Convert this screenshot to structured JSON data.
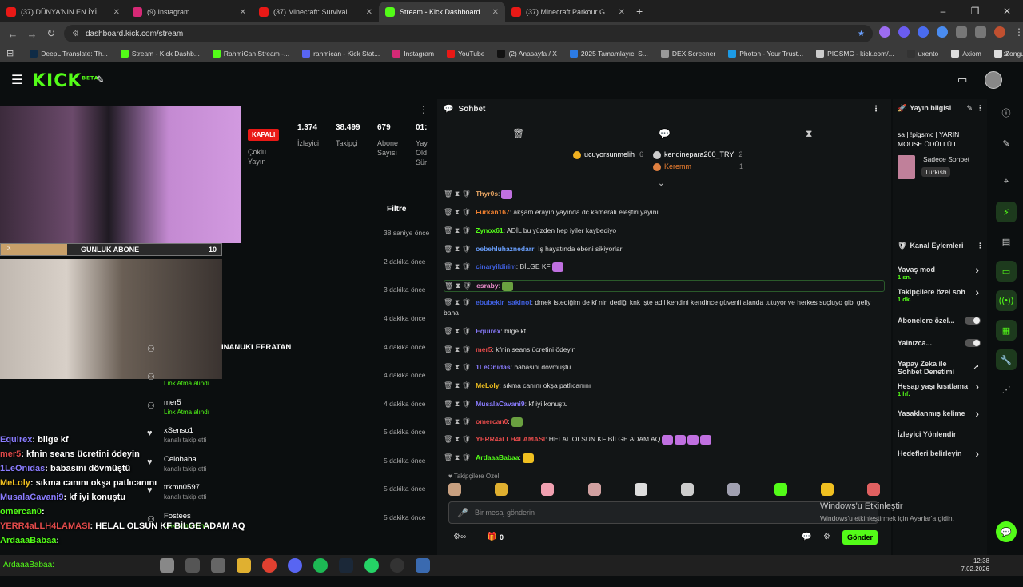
{
  "tabs": [
    {
      "title": "(37) DÜNYA'NIN EN İYİ PVPCİSİ",
      "color": "#e91916",
      "active": false
    },
    {
      "title": "(9) Instagram",
      "color": "#d62976",
      "active": false
    },
    {
      "title": "(37) Minecraft: Survival Games",
      "color": "#e91916",
      "active": false
    },
    {
      "title": "Stream - Kick Dashboard",
      "color": "#53fc18",
      "active": true
    },
    {
      "title": "(37) Minecraft Parkour Gameplay",
      "color": "#e91916",
      "active": false
    }
  ],
  "url": "dashboard.kick.com/stream",
  "bookmarks": [
    {
      "label": "DeepL Translate: Th...",
      "color": "#0f2b46"
    },
    {
      "label": "Stream - Kick Dashb...",
      "color": "#53fc18"
    },
    {
      "label": "RahmiCan Stream -...",
      "color": "#53fc18"
    },
    {
      "label": "rahmican - Kick Stat...",
      "color": "#5865f2"
    },
    {
      "label": "Instagram",
      "color": "#d62976"
    },
    {
      "label": "YouTube",
      "color": "#e91916"
    },
    {
      "label": "(2) Anasayfa / X",
      "color": "#111111"
    },
    {
      "label": "2025 Tamamlayıcı S...",
      "color": "#2c7be5"
    },
    {
      "label": "DEX Screener",
      "color": "#999999"
    },
    {
      "label": "Photon - Your Trust...",
      "color": "#1c9be6"
    },
    {
      "label": "PIGSMC - kick.com/...",
      "color": "#cccccc"
    },
    {
      "label": "uxento",
      "color": "#333333"
    },
    {
      "label": "Axiom",
      "color": "#dddddd"
    },
    {
      "label": "Zonguldak İngilizce...",
      "color": "#dddddd"
    }
  ],
  "kick": {
    "logo": "KICK",
    "logo_sup": "BETA"
  },
  "goal": {
    "label": "GUNLUK ABONE",
    "count": "10",
    "fill_fraction": 0.3,
    "stamp": "3"
  },
  "stats": {
    "status": "KAPALI",
    "status_sub": "Çoklu Yayın",
    "items": [
      {
        "value": "1.374",
        "label": "İzleyici"
      },
      {
        "value": "38.499",
        "label": "Takipçi"
      },
      {
        "value": "679",
        "label": "Abone Sayısı"
      },
      {
        "value": "01:",
        "label": "Yay Old Sür"
      }
    ]
  },
  "activity_filter": "Filtre",
  "activity": [
    {
      "name": "",
      "desc": "",
      "time": "38 saniye önce"
    },
    {
      "name": "",
      "desc": "",
      "time": "2 dakika önce"
    },
    {
      "name": "",
      "desc": "",
      "time": "3 dakika önce"
    },
    {
      "name": "",
      "desc": "",
      "time": "4 dakika önce"
    },
    {
      "name": "INANUKLEERATAN",
      "desc": "",
      "time": "4 dakika önce"
    },
    {
      "name": "",
      "desc": "Link Atma alındı",
      "time": "4 dakika önce"
    },
    {
      "name": "mer5",
      "desc": "Link Atma alındı",
      "time": "4 dakika önce"
    },
    {
      "name": "xSenso1",
      "desc": "kanalı takip etti",
      "time": "5 dakika önce"
    },
    {
      "name": "Celobaba",
      "desc": "kanalı takip etti",
      "time": "5 dakika önce"
    },
    {
      "name": "trkmn0597",
      "desc": "kanalı takip etti",
      "time": "5 dakika önce"
    },
    {
      "name": "Fostees",
      "desc": "Link Atma alındı",
      "time": "5 dakika önce"
    }
  ],
  "overlay_chat": [
    {
      "user": "Equirex",
      "text": ": bilge kf",
      "color": "#8a7cff"
    },
    {
      "user": "mer5",
      "text": ": kfnin seans ücretini ödeyin",
      "color": "#e24a4a"
    },
    {
      "user": "1LeOnidas",
      "text": ": babasini dövmüştü",
      "color": "#8a7cff"
    },
    {
      "user": "MeLoly",
      "text": ": sıkma canını okşa patlıcanını",
      "color": "#f0c020"
    },
    {
      "user": "MusalaCavani9",
      "text": ": kf iyi konuştu",
      "color": "#8a7cff"
    },
    {
      "user": "omercan0",
      "text": ":",
      "color": "#53fc18"
    },
    {
      "user": "YERR4aLLH4LAMASI",
      "text": ": HELAL OLSUN KF BİLGE ADAM AQ",
      "color": "#e24a4a"
    },
    {
      "user": "ArdaaaBabaa",
      "text": ":",
      "color": "#53fc18"
    }
  ],
  "chat": {
    "title": "Sohbet",
    "pinned": [
      {
        "user": "ucuyorsunmelih",
        "count": "6"
      },
      {
        "user": "kendinepara200_TRY",
        "count": "2"
      },
      {
        "user": "Keremm",
        "count": "1"
      }
    ],
    "messages": [
      {
        "user": "Thyr0s",
        "text": ":",
        "color": "#e0a060",
        "emotes": [
          "#c070e0"
        ]
      },
      {
        "user": "Furkan167",
        "text": ": akşam erayın yayında dc kameralı eleştiri yayını",
        "color": "#f08030",
        "emotes": []
      },
      {
        "user": "Zynox61",
        "text": ": ADİL bu yüzden hep iyiler kaybediyo",
        "color": "#53fc18",
        "emotes": []
      },
      {
        "user": "oebehluhaznedarr",
        "text": ": İş hayatında ebeni sikiyorlar",
        "color": "#6aa0ff",
        "emotes": []
      },
      {
        "user": "cinaryildirim",
        "text": ": BİLGE KF",
        "color": "#4060e0",
        "emotes": [
          "#c070e0"
        ]
      },
      {
        "user": "esraby",
        "text": ":",
        "color": "#f090d0",
        "emotes": [
          "#6aa040"
        ]
      },
      {
        "user": "ebubekir_sakinol",
        "text": ": dmek istediğim de kf nin dediği knk işte adil kendini kendince güvenli alanda tutuyor ve herkes suçluyo gibi geliy bana",
        "color": "#4060e0",
        "emotes": []
      },
      {
        "user": "Equirex",
        "text": ": bilge kf",
        "color": "#8a7cff",
        "emotes": []
      },
      {
        "user": "mer5",
        "text": ": kfnin seans ücretini ödeyin",
        "color": "#e24a4a",
        "emotes": []
      },
      {
        "user": "1LeOnidas",
        "text": ": babasini dövmüştü",
        "color": "#8a7cff",
        "emotes": []
      },
      {
        "user": "MeLoly",
        "text": ": sıkma canını okşa patlıcanını",
        "color": "#f0c020",
        "emotes": []
      },
      {
        "user": "MusalaCavani9",
        "text": ": kf iyi konuştu",
        "color": "#8a7cff",
        "emotes": []
      },
      {
        "user": "omercan0",
        "text": ":",
        "color": "#e24a4a",
        "emotes": [
          "#6aa040"
        ]
      },
      {
        "user": "YERR4aLLH4LAMASI",
        "text": ": HELAL OLSUN KF BİLGE ADAM AQ",
        "color": "#e24a4a",
        "emotes": [
          "#c070e0",
          "#c070e0",
          "#c070e0",
          "#c070e0"
        ]
      },
      {
        "user": "ArdaaaBabaa",
        "text": ":",
        "color": "#53fc18",
        "emotes": [
          "#f0c020"
        ]
      }
    ],
    "followers_only": "Takipçilere Özel",
    "placeholder": "Bir mesaj gönderin",
    "send": "Gönder",
    "counter": "0"
  },
  "stream_info": {
    "title": "Yayın bilgisi",
    "stream_title": "sa | !pigsmc | YARIN MOUSE ÖDÜLLÜ L...",
    "category": "Sadece Sohbet",
    "language": "Turkish"
  },
  "channel_actions": {
    "title": "Kanal Eylemleri",
    "items": [
      {
        "label": "Yavaş mod",
        "sub": "1 sn.",
        "type": "arrow"
      },
      {
        "label": "Takipçilere özel soh",
        "sub": "1 dk.",
        "type": "arrow"
      },
      {
        "label": "Abonelere özel...",
        "sub": "",
        "type": "toggle"
      },
      {
        "label": "Yalnızca...",
        "sub": "",
        "type": "toggle"
      },
      {
        "label": "Yapay Zeka ile Sohbet Denetimi",
        "sub": "",
        "type": "link"
      },
      {
        "label": "Hesap yaşı kısıtlama",
        "sub": "1 hf.",
        "type": "arrow"
      },
      {
        "label": "Yasaklanmış kelime",
        "sub": "",
        "type": "arrow"
      },
      {
        "label": "İzleyici Yönlendir",
        "sub": "",
        "type": "none"
      },
      {
        "label": "Hedefleri belirleyin",
        "sub": "",
        "type": "arrow"
      }
    ]
  },
  "windows": {
    "activate_title": "Windows'u Etkinleştir",
    "activate_sub": "Windows'u etkinleştirmek için Ayarlar'a gidin.",
    "time": "12:38",
    "date": "7.02.2026"
  }
}
